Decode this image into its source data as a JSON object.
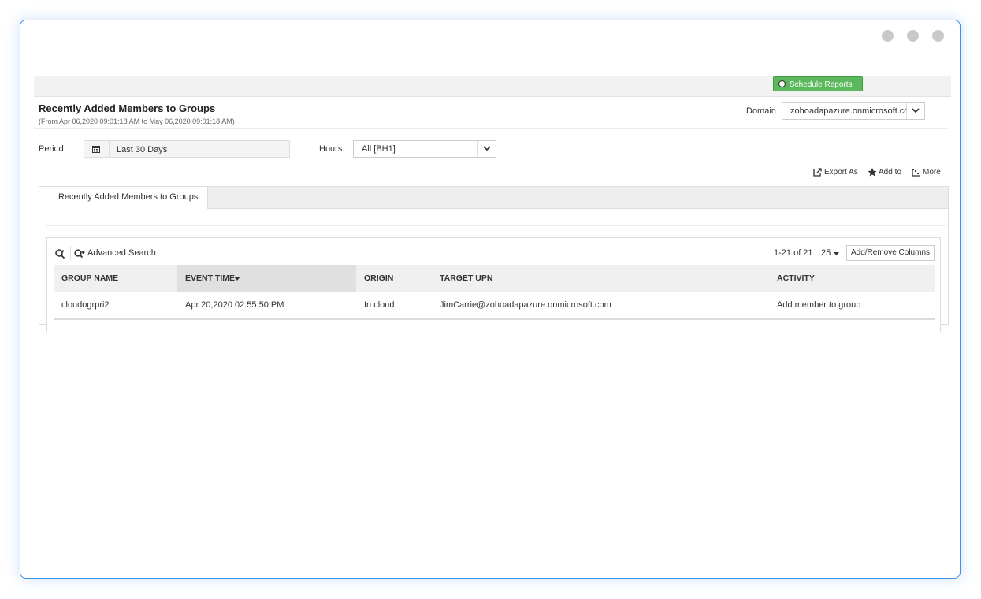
{
  "toolbar": {
    "schedule_label": "Schedule Reports"
  },
  "report": {
    "title": "Recently Added Members to Groups",
    "subtitle": "(From Apr 06,2020 09:01:18 AM to May 06,2020 09:01:18 AM)"
  },
  "domain": {
    "label": "Domain",
    "value": "zohoadapazure.onmicrosoft.com"
  },
  "filters": {
    "period_label": "Period",
    "period_value": "Last 30 Days",
    "hours_label": "Hours",
    "hours_value": "All [BH1]"
  },
  "actions": {
    "export": "Export As",
    "add_to": "Add to",
    "more": "More"
  },
  "tabs": [
    {
      "label": "Recently Added Members to Groups"
    }
  ],
  "grid": {
    "advanced_search": "Advanced Search",
    "paging": "1-21 of 21",
    "per_page": "25",
    "add_remove_columns": "Add/Remove Columns",
    "columns": [
      "GROUP NAME",
      "EVENT TIME",
      "ORIGIN",
      "TARGET UPN",
      "ACTIVITY"
    ],
    "sorted_column": "EVENT TIME",
    "rows": [
      {
        "group_name": "cloudogrpri2",
        "event_time": "Apr 20,2020 02:55:50 PM",
        "origin": "In cloud",
        "target_upn": "JimCarrie@zohoadapazure.onmicrosoft.com",
        "activity": "Add member to group"
      }
    ]
  },
  "colors": {
    "accent": "#3d8ee8",
    "schedule_green": "#5cb85c"
  }
}
